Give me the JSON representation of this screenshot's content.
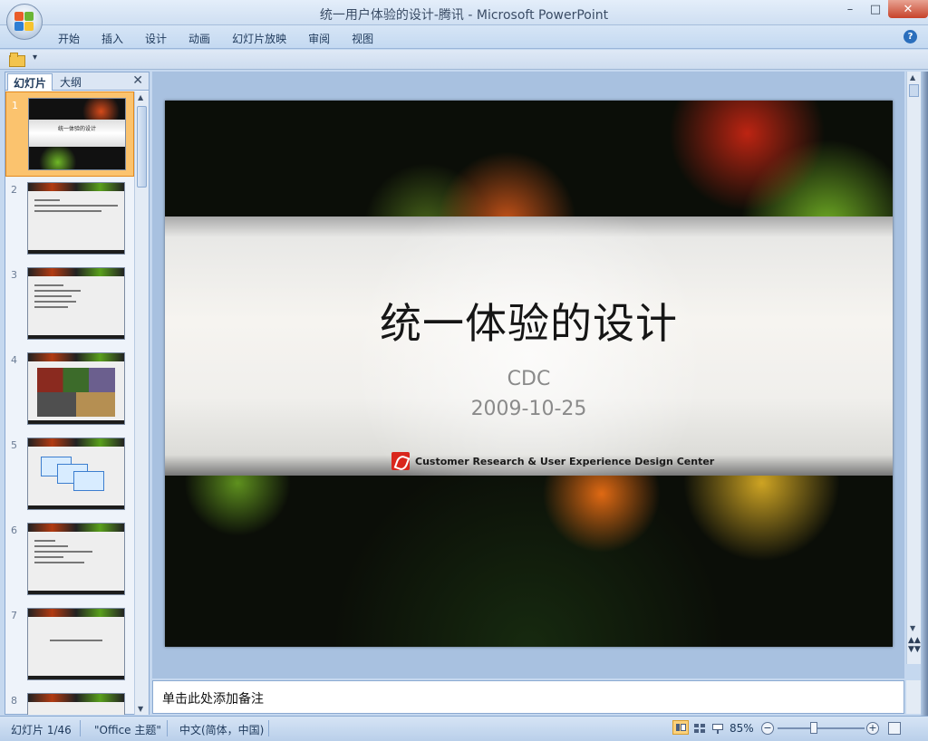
{
  "window": {
    "title": "统一用户体验的设计-腾讯 - Microsoft PowerPoint",
    "controls": {
      "minimize": "–",
      "maximize": "□",
      "close": "✕"
    }
  },
  "ribbon": {
    "tabs": [
      "开始",
      "插入",
      "设计",
      "动画",
      "幻灯片放映",
      "审阅",
      "视图"
    ],
    "help": "?"
  },
  "qat": {
    "more": "▾"
  },
  "slides_panel": {
    "tabs": {
      "slides": "幻灯片",
      "outline": "大纲"
    },
    "close": "✕",
    "thumbnails": [
      {
        "num": "1",
        "title": "统一体验的设计",
        "selected": true
      },
      {
        "num": "2",
        "title": ""
      },
      {
        "num": "3",
        "title": ""
      },
      {
        "num": "4",
        "title": ""
      },
      {
        "num": "5",
        "title": ""
      },
      {
        "num": "6",
        "title": ""
      },
      {
        "num": "7",
        "title": ""
      },
      {
        "num": "8",
        "title": ""
      }
    ]
  },
  "slide": {
    "title": "统一体验的设计",
    "subtitle": "CDC",
    "date": "2009-10-25",
    "org": "Customer Research & User Experience Design Center"
  },
  "notes": {
    "placeholder": "单击此处添加备注"
  },
  "status": {
    "slide_count": "幻灯片 1/46",
    "theme": "\"Office 主题\"",
    "language": "中文(简体，中国)",
    "zoom": "85%",
    "zoom_out": "−",
    "zoom_in": "+"
  }
}
